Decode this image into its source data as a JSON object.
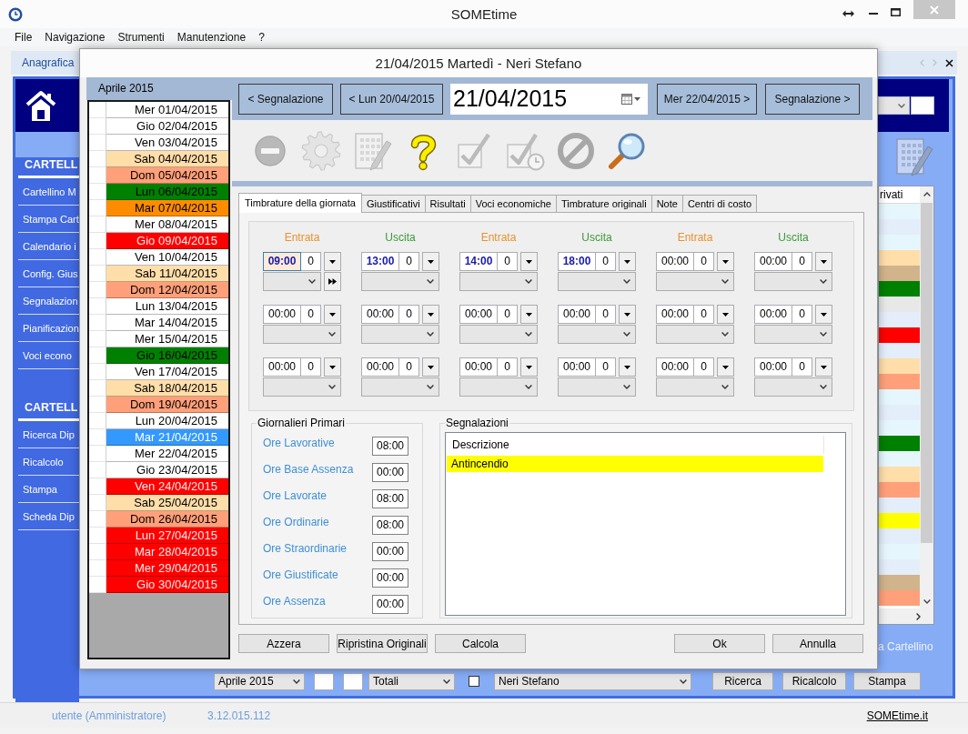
{
  "window": {
    "title": "SOMEtime"
  },
  "menu": [
    {
      "label": "File"
    },
    {
      "label": "Navigazione"
    },
    {
      "label": "Strumenti"
    },
    {
      "label": "Manutenzione"
    },
    {
      "label": "?"
    }
  ],
  "document_tab": {
    "label": "Anagrafica"
  },
  "sidebar": {
    "sections": [
      {
        "title": "CARTELL",
        "items": [
          "Cartellino M",
          "Stampa Cart",
          "Calendario i",
          "Config. Gius",
          "Segnalazion",
          "Pianificazion",
          "Voci econo"
        ]
      },
      {
        "title": "CARTELL",
        "items": [
          "Ricerca Dip",
          "Ricalcolo",
          "Stampa",
          "Scheda Dip"
        ]
      }
    ]
  },
  "background_panel": {
    "grid": {
      "column_header": "rivati",
      "rows": [
        {
          "color": "#e6f6fd"
        },
        {
          "color": "#e4eefa"
        },
        {
          "color": "#e6f6fd"
        },
        {
          "color": "#ffdeaa"
        },
        {
          "color": "#d2b48c"
        },
        {
          "color": "#008000"
        },
        {
          "color": "#e8e8e8"
        },
        {
          "color": "#e4eefa"
        },
        {
          "color": "#ff0000"
        },
        {
          "color": "#e4eefa"
        },
        {
          "color": "#ffdeaa"
        },
        {
          "color": "#ffa07a"
        },
        {
          "color": "#e6f6fd"
        },
        {
          "color": "#e4eefa"
        },
        {
          "color": "#e6f6fd"
        },
        {
          "color": "#008000"
        },
        {
          "color": "#e6f6fd"
        },
        {
          "color": "#ffdeaa"
        },
        {
          "color": "#ffa07a"
        },
        {
          "color": "#e4eefa"
        },
        {
          "color": "#ffff00"
        },
        {
          "color": "#e4eefa"
        },
        {
          "color": "#e6f6fd"
        },
        {
          "color": "#e4eefa"
        },
        {
          "color": "#d2b48c"
        },
        {
          "color": "#ffa07a"
        }
      ]
    },
    "caption": "a Cartellino"
  },
  "bottom_controls": {
    "month": "Aprile 2015",
    "view": "Totali",
    "checked": false,
    "employee": "Neri Stefano",
    "buttons": [
      "Ricerca",
      "Ricalcolo",
      "Stampa"
    ]
  },
  "status_bar": {
    "user": "utente (Amministratore)",
    "version": "3.12.015.112",
    "link": "SOMEtime.it"
  },
  "dialog": {
    "title": "21/04/2015 Martedì - Neri Stefano",
    "calendar": {
      "month": "Aprile 2015",
      "days": [
        {
          "label": "Mer 01/04/2015",
          "color": "#ffffff",
          "selected": false
        },
        {
          "label": "Gio 02/04/2015",
          "color": "#ffffff",
          "selected": false
        },
        {
          "label": "Ven 03/04/2015",
          "color": "#ffffff",
          "selected": false
        },
        {
          "label": "Sab 04/04/2015",
          "color": "#ffdeaa",
          "selected": false
        },
        {
          "label": "Dom 05/04/2015",
          "color": "#ffa07a",
          "selected": false
        },
        {
          "label": "Lun 06/04/2015",
          "color": "#008000",
          "selected": false
        },
        {
          "label": "Mar 07/04/2015",
          "color": "#ff8c00",
          "selected": false
        },
        {
          "label": "Mer 08/04/2015",
          "color": "#ffffff",
          "selected": false
        },
        {
          "label": "Gio 09/04/2015",
          "color": "#ff0000",
          "selected": false
        },
        {
          "label": "Ven 10/04/2015",
          "color": "#ffffff",
          "selected": false
        },
        {
          "label": "Sab 11/04/2015",
          "color": "#ffdeaa",
          "selected": false
        },
        {
          "label": "Dom 12/04/2015",
          "color": "#ffa07a",
          "selected": false
        },
        {
          "label": "Lun 13/04/2015",
          "color": "#ffffff",
          "selected": false
        },
        {
          "label": "Mar 14/04/2015",
          "color": "#ffffff",
          "selected": false
        },
        {
          "label": "Mer 15/04/2015",
          "color": "#ffffff",
          "selected": false
        },
        {
          "label": "Gio 16/04/2015",
          "color": "#008000",
          "selected": false
        },
        {
          "label": "Ven 17/04/2015",
          "color": "#ffffff",
          "selected": false
        },
        {
          "label": "Sab 18/04/2015",
          "color": "#ffdeaa",
          "selected": false
        },
        {
          "label": "Dom 19/04/2015",
          "color": "#ffa07a",
          "selected": false
        },
        {
          "label": "Lun 20/04/2015",
          "color": "#ffffff",
          "selected": false
        },
        {
          "label": "Mar 21/04/2015",
          "color": "#3399ff",
          "selected": true
        },
        {
          "label": "Mer 22/04/2015",
          "color": "#ffffff",
          "selected": false
        },
        {
          "label": "Gio 23/04/2015",
          "color": "#ffffff",
          "selected": false
        },
        {
          "label": "Ven 24/04/2015",
          "color": "#ff0000",
          "selected": false
        },
        {
          "label": "Sab 25/04/2015",
          "color": "#ffdeaa",
          "selected": false
        },
        {
          "label": "Dom 26/04/2015",
          "color": "#ffa07a",
          "selected": false
        },
        {
          "label": "Lun 27/04/2015",
          "color": "#ff0000",
          "selected": false
        },
        {
          "label": "Mar 28/04/2015",
          "color": "#ff0000",
          "selected": false
        },
        {
          "label": "Mer 29/04/2015",
          "color": "#ff0000",
          "selected": false
        },
        {
          "label": "Gio 30/04/2015",
          "color": "#ff0000",
          "selected": false
        }
      ]
    },
    "navigation": {
      "previous_signal": "< Segnalazione",
      "previous_day": "< Lun 20/04/2015",
      "date": "21/04/2015",
      "next_day": "Mer 22/04/2015 >",
      "next_signal": "Segnalazione >"
    },
    "toolbar": [
      {
        "kind": "minus",
        "disabled": true
      },
      {
        "kind": "gear",
        "disabled": true
      },
      {
        "kind": "notes",
        "disabled": true
      },
      {
        "kind": "help",
        "disabled": false
      },
      {
        "kind": "check",
        "disabled": true
      },
      {
        "kind": "check_clock",
        "disabled": true
      },
      {
        "kind": "forbid",
        "disabled": true
      },
      {
        "kind": "search",
        "disabled": false
      }
    ],
    "tabs": [
      {
        "label": "Timbrature della giornata",
        "selected": true
      },
      {
        "label": "Giustificativi",
        "selected": false
      },
      {
        "label": "Risultati",
        "selected": false
      },
      {
        "label": "Voci economiche",
        "selected": false
      },
      {
        "label": "Timbrature originali",
        "selected": false
      },
      {
        "label": "Note",
        "selected": false
      },
      {
        "label": "Centri di costo",
        "selected": false
      }
    ],
    "punch_columns": [
      {
        "label": "Entrata",
        "kind": "in"
      },
      {
        "label": "Uscita",
        "kind": "out"
      },
      {
        "label": "Entrata",
        "kind": "in"
      },
      {
        "label": "Uscita",
        "kind": "out"
      },
      {
        "label": "Entrata",
        "kind": "in"
      },
      {
        "label": "Uscita",
        "kind": "out"
      }
    ],
    "punch_rows": [
      {
        "slots": [
          {
            "time": "09:00",
            "count": "0",
            "filled": true,
            "focused": true,
            "forward_button": true
          },
          {
            "time": "13:00",
            "count": "0",
            "filled": true,
            "focused": false,
            "forward_button": false
          },
          {
            "time": "14:00",
            "count": "0",
            "filled": true,
            "focused": false,
            "forward_button": false
          },
          {
            "time": "18:00",
            "count": "0",
            "filled": true,
            "focused": false,
            "forward_button": false
          },
          {
            "time": "00:00",
            "count": "0",
            "filled": false,
            "focused": false,
            "forward_button": false
          },
          {
            "time": "00:00",
            "count": "0",
            "filled": false,
            "focused": false,
            "forward_button": false
          }
        ]
      },
      {
        "slots": [
          {
            "time": "00:00",
            "count": "0",
            "filled": false,
            "focused": false,
            "forward_button": false
          },
          {
            "time": "00:00",
            "count": "0",
            "filled": false,
            "focused": false,
            "forward_button": false
          },
          {
            "time": "00:00",
            "count": "0",
            "filled": false,
            "focused": false,
            "forward_button": false
          },
          {
            "time": "00:00",
            "count": "0",
            "filled": false,
            "focused": false,
            "forward_button": false
          },
          {
            "time": "00:00",
            "count": "0",
            "filled": false,
            "focused": false,
            "forward_button": false
          },
          {
            "time": "00:00",
            "count": "0",
            "filled": false,
            "focused": false,
            "forward_button": false
          }
        ]
      },
      {
        "slots": [
          {
            "time": "00:00",
            "count": "0",
            "filled": false,
            "focused": false,
            "forward_button": false
          },
          {
            "time": "00:00",
            "count": "0",
            "filled": false,
            "focused": false,
            "forward_button": false
          },
          {
            "time": "00:00",
            "count": "0",
            "filled": false,
            "focused": false,
            "forward_button": false
          },
          {
            "time": "00:00",
            "count": "0",
            "filled": false,
            "focused": false,
            "forward_button": false
          },
          {
            "time": "00:00",
            "count": "0",
            "filled": false,
            "focused": false,
            "forward_button": false
          },
          {
            "time": "00:00",
            "count": "0",
            "filled": false,
            "focused": false,
            "forward_button": false
          }
        ]
      }
    ],
    "daily_totals": {
      "title": "Giornalieri Primari",
      "items": [
        {
          "label": "Ore Lavorative",
          "value": "08:00"
        },
        {
          "label": "Ore Base Assenza",
          "value": "00:00"
        },
        {
          "label": "Ore Lavorate",
          "value": "08:00"
        },
        {
          "label": "Ore Ordinarie",
          "value": "08:00"
        },
        {
          "label": "Ore Straordinarie",
          "value": "00:00"
        },
        {
          "label": "Ore Giustificate",
          "value": "00:00"
        },
        {
          "label": "Ore Assenza",
          "value": "00:00"
        }
      ]
    },
    "signals": {
      "title": "Segnalazioni",
      "columns": [
        "Descrizione"
      ],
      "rows": [
        {
          "cells": [
            "Antincendio"
          ],
          "color": "#ffff00"
        }
      ]
    },
    "buttons_left": [
      "Azzera",
      "Ripristina Originali",
      "Calcola"
    ],
    "buttons_right": [
      "Ok",
      "Annulla"
    ]
  }
}
